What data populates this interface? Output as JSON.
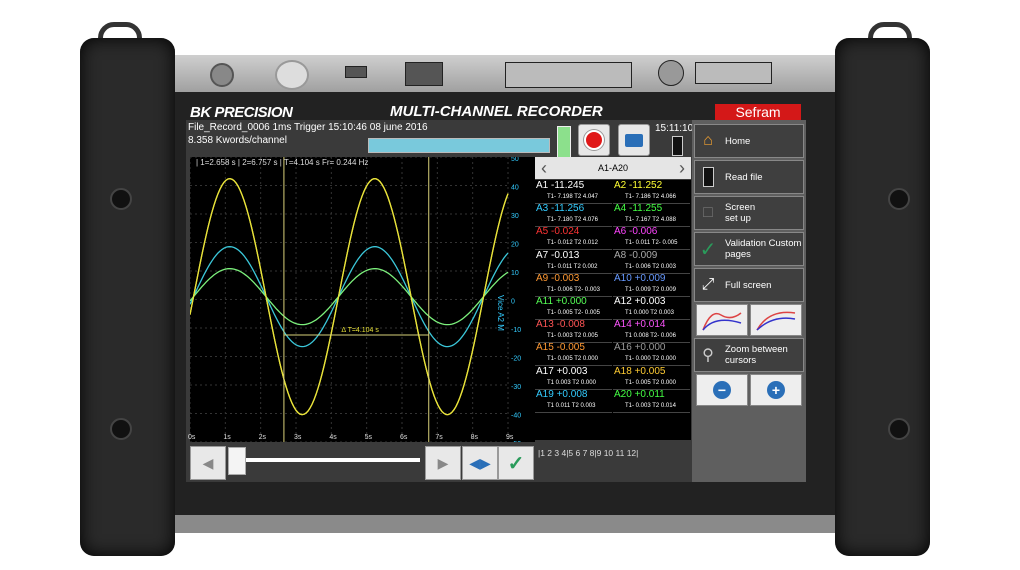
{
  "header": {
    "brand": "BK PRECISION",
    "title": "MULTI-CHANNEL RECORDER",
    "sefram": "Sefram"
  },
  "status": {
    "record_line": "File_Record_0006  1ms  Trigger 15:10:46 08 june 2016",
    "kwords_line": "8.358 Kwords/channel",
    "clock": "15:11:10",
    "progress": 1.0
  },
  "cursors": {
    "text": "| 1=2.658 s | 2=6.757 s | T=4.104 s Fr= 0.244 Hz",
    "delta": "Δ T=4.104 s"
  },
  "axes": {
    "x_ticks": [
      "0s",
      "1s",
      "2s",
      "3s",
      "4s",
      "5s",
      "6s",
      "7s",
      "8s",
      "9s"
    ],
    "y_ticks": [
      "50",
      "40",
      "30",
      "20",
      "10",
      "0",
      "-10",
      "-20",
      "-30",
      "-40",
      "-50"
    ],
    "ylabel": "Vice A2 M"
  },
  "channels_header": {
    "label": "A1-A20"
  },
  "channels": [
    {
      "name": "A1",
      "value": "-11.245",
      "stats": "T1- 7.198 T2  4.047",
      "color": "#ffffff"
    },
    {
      "name": "A2",
      "value": "-11.252",
      "stats": "T1- 7.186 T2  4.066",
      "color": "#ffff33"
    },
    {
      "name": "A3",
      "value": "-11.256",
      "stats": "T1- 7.180 T2  4.076",
      "color": "#33ccff"
    },
    {
      "name": "A4",
      "value": "-11.255",
      "stats": "T1- 7.167 T2  4.088",
      "color": "#44ff44"
    },
    {
      "name": "A5",
      "value": "-0.024",
      "stats": "T1- 0.012 T2  0.012",
      "color": "#ff3333"
    },
    {
      "name": "A6",
      "value": "-0.006",
      "stats": "T1- 0.011 T2- 0.005",
      "color": "#ff44ff"
    },
    {
      "name": "A7",
      "value": "-0.013",
      "stats": "T1- 0.011 T2  0.002",
      "color": "#ffffff"
    },
    {
      "name": "A8",
      "value": "-0.009",
      "stats": "T1- 0.006 T2  0.003",
      "color": "#aaaaaa"
    },
    {
      "name": "A9",
      "value": "-0.003",
      "stats": "T1- 0.006 T2- 0.003",
      "color": "#ff9933"
    },
    {
      "name": "A10",
      "value": "+0.009",
      "stats": "T1- 0.009 T2  0.009",
      "color": "#6699ff"
    },
    {
      "name": "A11",
      "value": "+0.000",
      "stats": "T1- 0.005 T2- 0.005",
      "color": "#55ff55"
    },
    {
      "name": "A12",
      "value": "+0.003",
      "stats": "T1  0.000 T2  0.003",
      "color": "#ffffff"
    },
    {
      "name": "A13",
      "value": "-0.008",
      "stats": "T1- 0.003 T2  0.005",
      "color": "#ff5555"
    },
    {
      "name": "A14",
      "value": "+0.014",
      "stats": "T1  0.008 T2- 0.006",
      "color": "#ff55ff"
    },
    {
      "name": "A15",
      "value": "-0.005",
      "stats": "T1- 0.005 T2  0.000",
      "color": "#ff9933"
    },
    {
      "name": "A16",
      "value": "+0.000",
      "stats": "T1- 0.000 T2  0.000",
      "color": "#999999"
    },
    {
      "name": "A17",
      "value": "+0.003",
      "stats": "T1  0.003 T2  0.000",
      "color": "#ffffff"
    },
    {
      "name": "A18",
      "value": "+0.005",
      "stats": "T1- 0.005 T2  0.000",
      "color": "#ffcc33"
    },
    {
      "name": "A19",
      "value": "+0.008",
      "stats": "T1  0.011 T2  0.003",
      "color": "#33ccff"
    },
    {
      "name": "A20",
      "value": "+0.011",
      "stats": "T1- 0.003 T2  0.014",
      "color": "#44ff44"
    }
  ],
  "pages": "|1  2  3  4|5  6  7  8|9 10 11 12|",
  "menu": {
    "home": "Home",
    "read_file": "Read file",
    "screen_setup_1": "Screen",
    "screen_setup_2": "set up",
    "validation_1": "Validation Custom",
    "validation_2": "pages",
    "full_screen": "Full screen",
    "zoom_1": "Zoom between",
    "zoom_2": "cursors"
  },
  "colors": {
    "trace_yellow": "#e8e23a",
    "trace_cyan": "#3bc7d9",
    "trace_green": "#7cf07c",
    "brand_red": "#d41818"
  }
}
